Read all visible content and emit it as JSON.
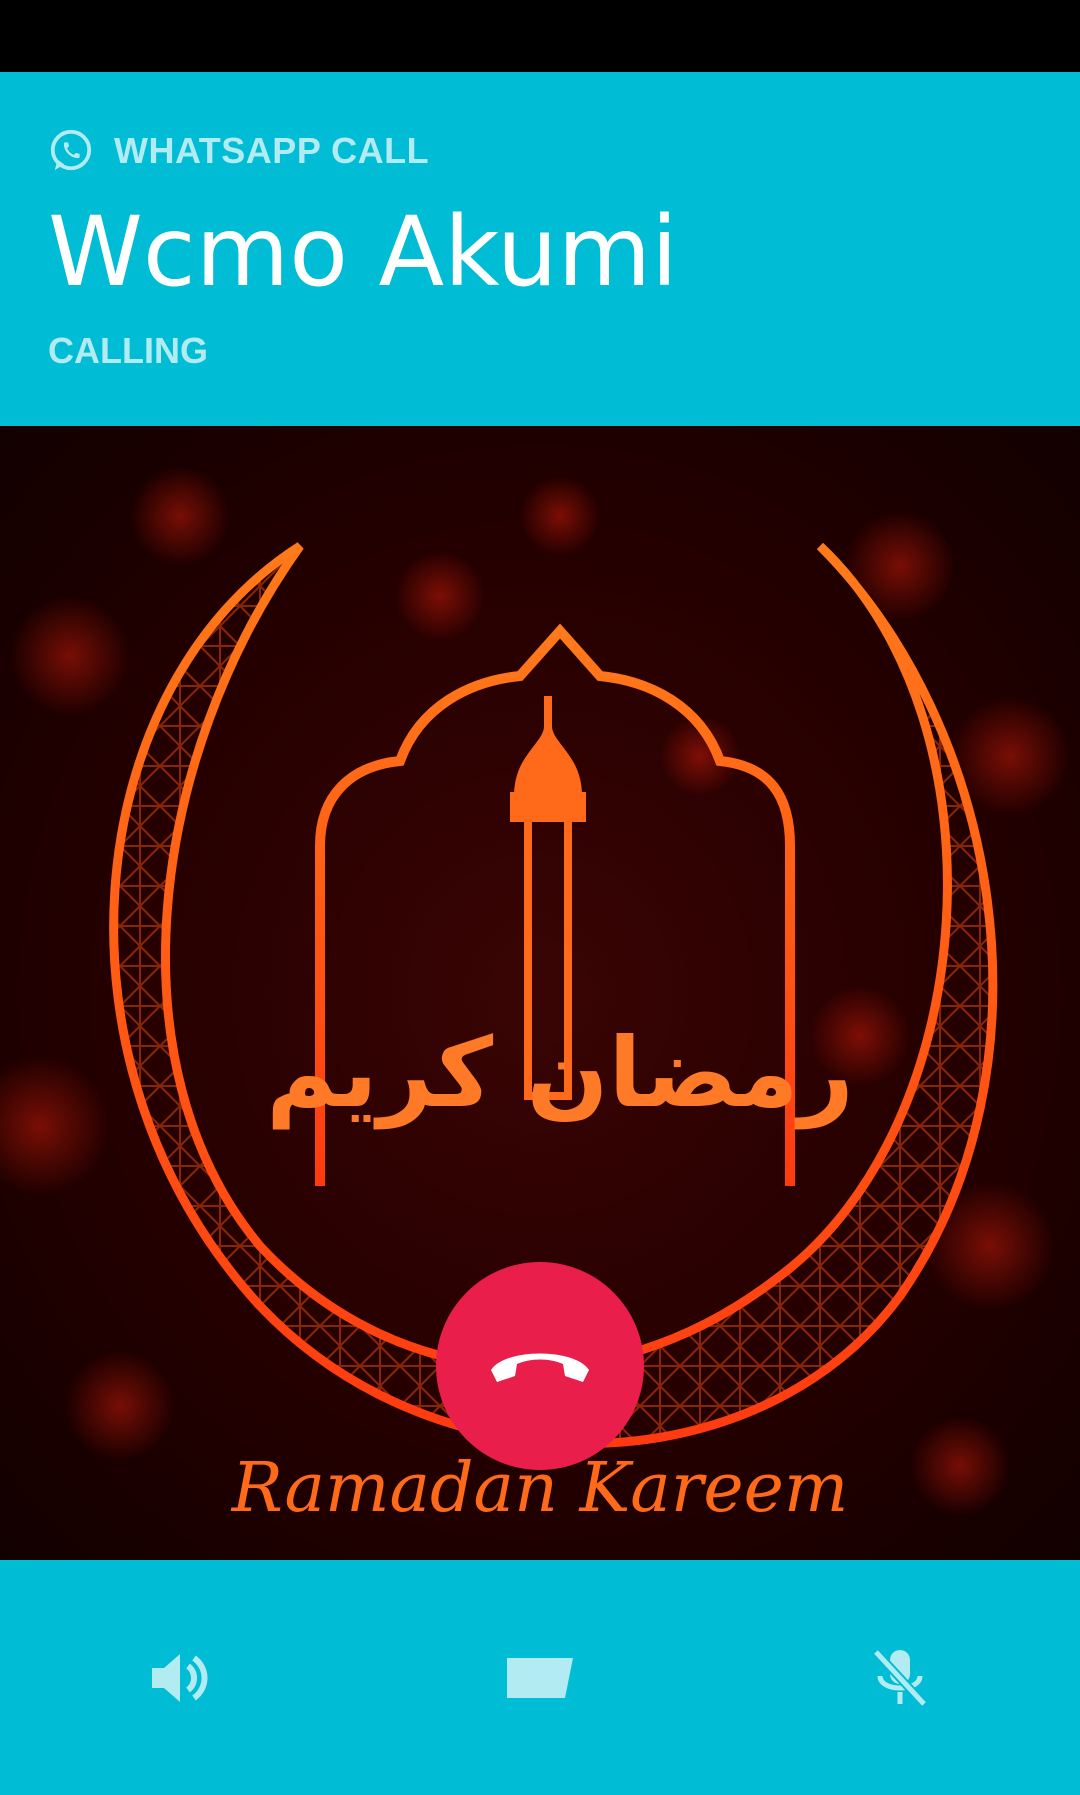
{
  "header": {
    "app_label": "WHATSAPP CALL",
    "contact_name": "Wcmo Akumi",
    "call_status": "CALLING"
  },
  "photo": {
    "caption": "Ramadan Kareem",
    "calligraphy": "رمضان كريم"
  },
  "controls": {
    "speaker_icon": "speaker-icon",
    "video_icon": "video-icon",
    "mute_icon": "mic-off-icon",
    "end_call_icon": "phone-hangup-icon"
  },
  "colors": {
    "header_bg": "#00bcd4",
    "label_tint": "#b2ebf2",
    "end_call": "#e91e4a",
    "artwork_glow": "#ff5a1a"
  }
}
